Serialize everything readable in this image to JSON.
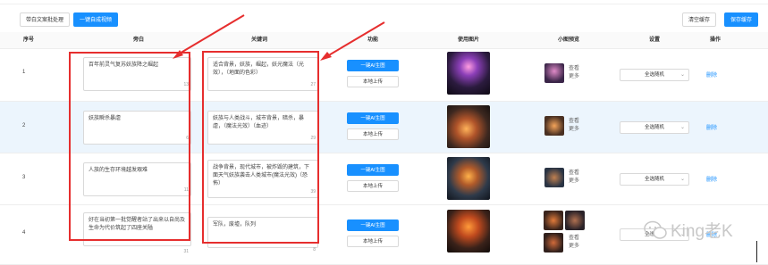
{
  "toolbar": {
    "batch_btn": "带白文案批处理",
    "generate_btn": "一键自成视频",
    "clear_cache_btn": "清空缓存",
    "save_cache_btn": "保存缓存"
  },
  "table": {
    "headers": {
      "index": "序号",
      "narration": "旁白",
      "keywords": "关键词",
      "function": "功能",
      "used_image": "使用图片",
      "thumb_preview": "小图预览",
      "settings": "设置",
      "action": "操作"
    },
    "ai_gen_label": "一键AI生图",
    "local_upload_label": "本地上传",
    "select_value": "全选随机",
    "delete_label": "删除",
    "view_label": "查看",
    "more_label": "更多",
    "rows": [
      {
        "index": "1",
        "narration": "百年前灵气复苏妖族降之崛起",
        "narration_count": "13",
        "keywords": "适合背景，妖族，崛起，妖光魔法（光效），（地面的色彩）",
        "keywords_count": "27"
      },
      {
        "index": "2",
        "narration": "妖族瞬杀暴虐",
        "narration_count": "6",
        "keywords": "妖族与人类战斗，城市背景，暗杀，暴虐，（魔法光效）（血迹）",
        "keywords_count": "29"
      },
      {
        "index": "3",
        "narration": "人族的生存环境越发艰难",
        "narration_count": "11",
        "keywords": "战争背景，现代城市，被炸毁的建筑，下面天气妖族袭击人类城市(魔法光效)（恐怖）",
        "keywords_count": "39"
      },
      {
        "index": "4",
        "narration": "好在当初第一批觉醒者站了出来以自尚及生命为代价筑起了四座关隘",
        "narration_count": "31",
        "keywords": "军队，废墟，队列",
        "keywords_count": "8"
      }
    ]
  },
  "watermark": {
    "text": "King老K"
  },
  "colors": {
    "primary": "#1890ff",
    "highlight": "#e62e2e",
    "row_alt": "#ecf5fd"
  }
}
